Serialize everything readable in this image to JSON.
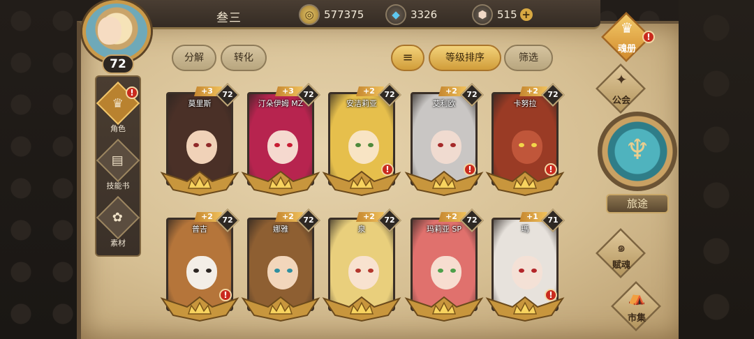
{
  "player": {
    "name": "叁三",
    "level": "72"
  },
  "currencies": [
    {
      "name": "gold-coin-icon",
      "value": "577375"
    },
    {
      "name": "blue-crystal-icon",
      "value": "3326"
    },
    {
      "name": "gem-icon",
      "value": "515",
      "has_plus": true
    }
  ],
  "sidebar": {
    "items": [
      {
        "label": "角色",
        "active": true,
        "alert": true
      },
      {
        "label": "技能书",
        "active": false,
        "alert": false
      },
      {
        "label": "素材",
        "active": false,
        "alert": false
      }
    ]
  },
  "actions": {
    "decompose": "分解",
    "convert": "转化",
    "sort_level": "等级排序",
    "filter": "筛选"
  },
  "alert_mark": "!",
  "cards": [
    {
      "name": "莫里斯",
      "stars": "+3",
      "level": "72",
      "hair": "#4a3027",
      "skin": "#f0d2b8",
      "eyes": "#8f2a2a",
      "alert": false
    },
    {
      "name": "汀朵伊姆 MZ",
      "stars": "+3",
      "level": "72",
      "hair": "#b7244f",
      "skin": "#f5d9cf",
      "eyes": "#c81d34",
      "alert": false
    },
    {
      "name": "安洁莉亚",
      "stars": "+2",
      "level": "72",
      "hair": "#e6bf4c",
      "skin": "#f8e4c4",
      "eyes": "#4f8a3b",
      "alert": true
    },
    {
      "name": "艾利欧",
      "stars": "+2",
      "level": "72",
      "hair": "#c9c6c4",
      "skin": "#f0dbd0",
      "eyes": "#a52a2a",
      "alert": true
    },
    {
      "name": "卡努拉",
      "stars": "+2",
      "level": "72",
      "hair": "#9a3b25",
      "skin": "#c0563a",
      "eyes": "#f2d54a",
      "alert": true
    },
    {
      "name": "普吉",
      "stars": "+2",
      "level": "72",
      "hair": "#b5753a",
      "skin": "#f3eee7",
      "eyes": "#2c2623",
      "alert": true
    },
    {
      "name": "娜雅",
      "stars": "+2",
      "level": "72",
      "hair": "#8e5f32",
      "skin": "#f2d6bb",
      "eyes": "#2f8fa0",
      "alert": false
    },
    {
      "name": "泉",
      "stars": "+2",
      "level": "72",
      "hair": "#e9cf7c",
      "skin": "#f8e2cf",
      "eyes": "#b3362c",
      "alert": false
    },
    {
      "name": "玛莉亚 SP",
      "stars": "+2",
      "level": "72",
      "hair": "#e0716d",
      "skin": "#f7ddd0",
      "eyes": "#4da04a",
      "alert": false
    },
    {
      "name": "瑪",
      "stars": "+1",
      "level": "71",
      "hair": "#e7e2dc",
      "skin": "#f4e1d6",
      "eyes": "#b3262a",
      "alert": true
    }
  ],
  "right_nav": {
    "soul_book": "魂册",
    "guild": "公会",
    "journey": "旅途",
    "talent": "赋魂",
    "market": "市集"
  },
  "colors": {
    "alert_red": "#c92a1e",
    "gold_accent": "#d8a942",
    "teal_accent": "#4fb3be"
  }
}
